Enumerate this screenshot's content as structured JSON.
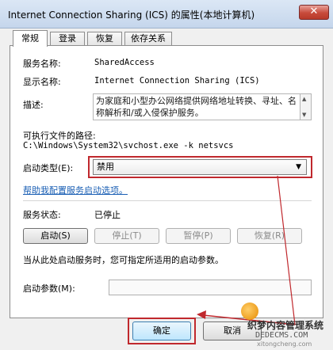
{
  "window": {
    "title": "Internet Connection Sharing (ICS) 的属性(本地计算机)",
    "close_glyph": "✕"
  },
  "tabs": [
    {
      "label": "常规",
      "active": true
    },
    {
      "label": "登录",
      "active": false
    },
    {
      "label": "恢复",
      "active": false
    },
    {
      "label": "依存关系",
      "active": false
    }
  ],
  "general": {
    "service_name_label": "服务名称:",
    "service_name_value": "SharedAccess",
    "display_name_label": "显示名称:",
    "display_name_value": "Internet Connection Sharing (ICS)",
    "description_label": "描述:",
    "description_value": "为家庭和小型办公网络提供网络地址转换、寻址、名称解析和/或入侵保护服务。",
    "exe_path_label": "可执行文件的路径:",
    "exe_path_value": "C:\\Windows\\System32\\svchost.exe -k netsvcs",
    "startup_type_label": "启动类型(E):",
    "startup_type_value": "禁用",
    "help_link": "帮助我配置服务启动选项。",
    "status_label": "服务状态:",
    "status_value": "已停止",
    "buttons": {
      "start": "启动(S)",
      "stop": "停止(T)",
      "pause": "暂停(P)",
      "resume": "恢复(R)"
    },
    "hint": "当从此处启动服务时，您可指定所适用的启动参数。",
    "param_label": "启动参数(M):",
    "param_value": ""
  },
  "footer": {
    "ok": "确定",
    "cancel": "取消"
  },
  "watermark": {
    "line1": "织梦内容管理系统",
    "line2": "DEDECMS.COM",
    "line3": "xitongcheng.com"
  },
  "colors": {
    "highlight": "#c0282d",
    "link": "#1a5fb4"
  }
}
